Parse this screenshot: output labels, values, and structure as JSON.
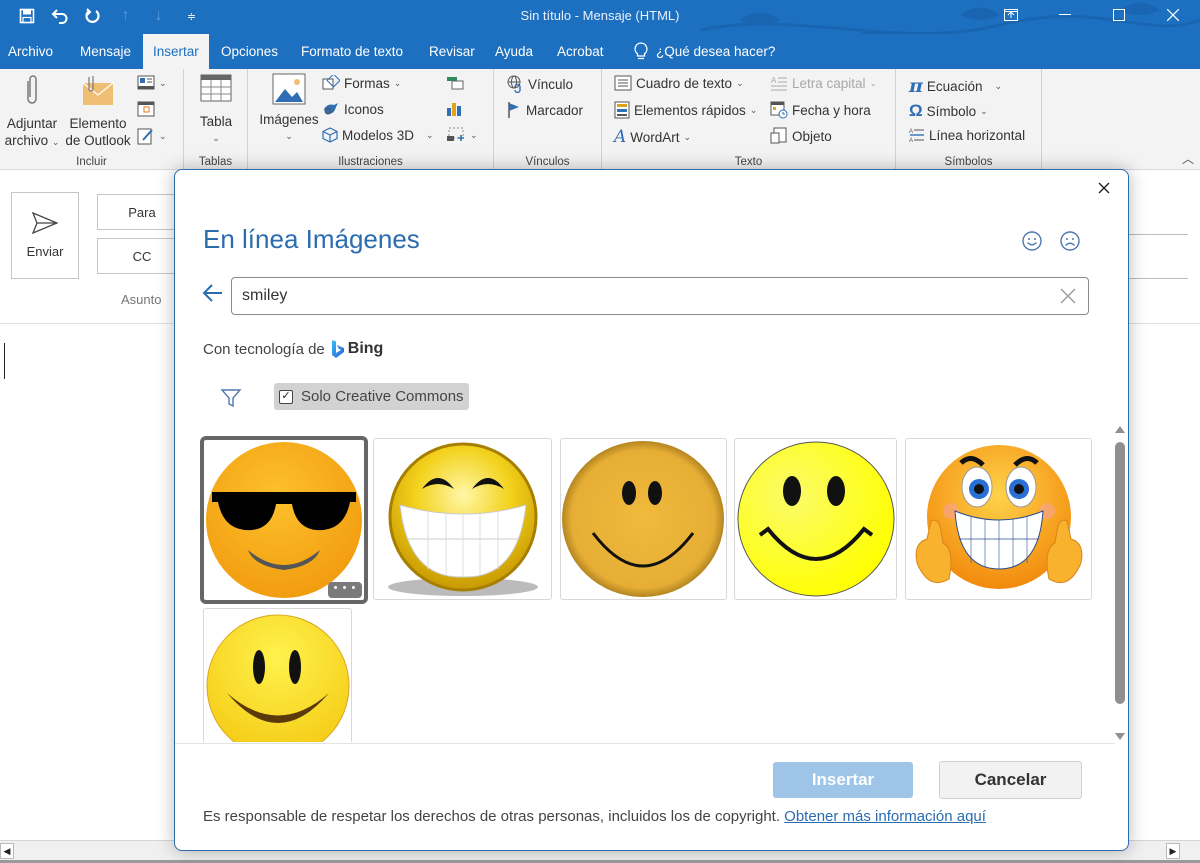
{
  "window": {
    "title": "Sin título  -  Mensaje (HTML)",
    "qat": [
      {
        "icon": "save-icon",
        "glyph": "🖫"
      },
      {
        "icon": "undo-icon",
        "glyph": "↶"
      },
      {
        "icon": "redo-icon",
        "glyph": "↻"
      },
      {
        "icon": "previous-item-icon",
        "glyph": "↑"
      },
      {
        "icon": "next-item-icon",
        "glyph": "↓"
      },
      {
        "icon": "customize-qat-icon",
        "glyph": "≑"
      }
    ],
    "controls": {
      "ribbon_display": "▣",
      "minimize": "—",
      "maximize": "☐",
      "close": "✕"
    }
  },
  "tabs": [
    {
      "label": "Archivo",
      "active": false
    },
    {
      "label": "Mensaje",
      "active": false
    },
    {
      "label": "Insertar",
      "active": true
    },
    {
      "label": "Opciones",
      "active": false
    },
    {
      "label": "Formato de texto",
      "active": false
    },
    {
      "label": "Revisar",
      "active": false
    },
    {
      "label": "Ayuda",
      "active": false
    },
    {
      "label": "Acrobat",
      "active": false
    }
  ],
  "tell_me": {
    "placeholder": "¿Qué desea hacer?"
  },
  "ribbon": {
    "incluir": {
      "label": "Incluir",
      "adjuntar": [
        "Adjuntar",
        "archivo"
      ],
      "elemento": [
        "Elemento",
        "de Outlook"
      ]
    },
    "tablas": {
      "label": "Tablas",
      "tabla": "Tabla"
    },
    "ilustraciones": {
      "label": "Ilustraciones",
      "imagenes": "Imágenes",
      "formas": "Formas",
      "iconos": "Iconos",
      "modelos3d": "Modelos 3D"
    },
    "vinculos": {
      "label": "Vínculos",
      "vinculo": "Vínculo",
      "marcador": "Marcador"
    },
    "texto": {
      "label": "Texto",
      "cuadro": "Cuadro de texto",
      "elementos": "Elementos rápidos",
      "wordart": "WordArt",
      "letra_capital": "Letra capital",
      "fecha": "Fecha y hora",
      "objeto": "Objeto"
    },
    "simbolos": {
      "label": "Símbolos",
      "ecuacion": "Ecuación",
      "simbolo": "Símbolo",
      "linea": "Línea horizontal"
    }
  },
  "compose": {
    "send": "Enviar",
    "to": "Para",
    "cc": "CC",
    "subject": "Asunto"
  },
  "dialog": {
    "title": "En línea Imágenes",
    "search_value": "smiley",
    "powered_by": "Con tecnología de",
    "bing": "Bing",
    "filter_label": "Solo Creative Commons",
    "filter_checked": true,
    "results": [
      {
        "name": "sunglasses-smiley",
        "selected": true
      },
      {
        "name": "grinning-teeth-smiley",
        "selected": false
      },
      {
        "name": "glossy-orange-smiley",
        "selected": false
      },
      {
        "name": "classic-yellow-smiley",
        "selected": false
      },
      {
        "name": "thumbs-up-smiley",
        "selected": false
      },
      {
        "name": "yellow-smiley",
        "selected": false
      }
    ],
    "more_label": "• • •",
    "insert": "Insertar",
    "cancel": "Cancelar",
    "disclaimer": "Es responsable de respetar los derechos de otras personas, incluidos los de copyright.",
    "learn_more": "Obtener más información aquí"
  },
  "colors": {
    "brand": "#1d6fbf",
    "dialog_accent": "#2b6cb0",
    "insert_disabled": "#9ec5e8"
  }
}
